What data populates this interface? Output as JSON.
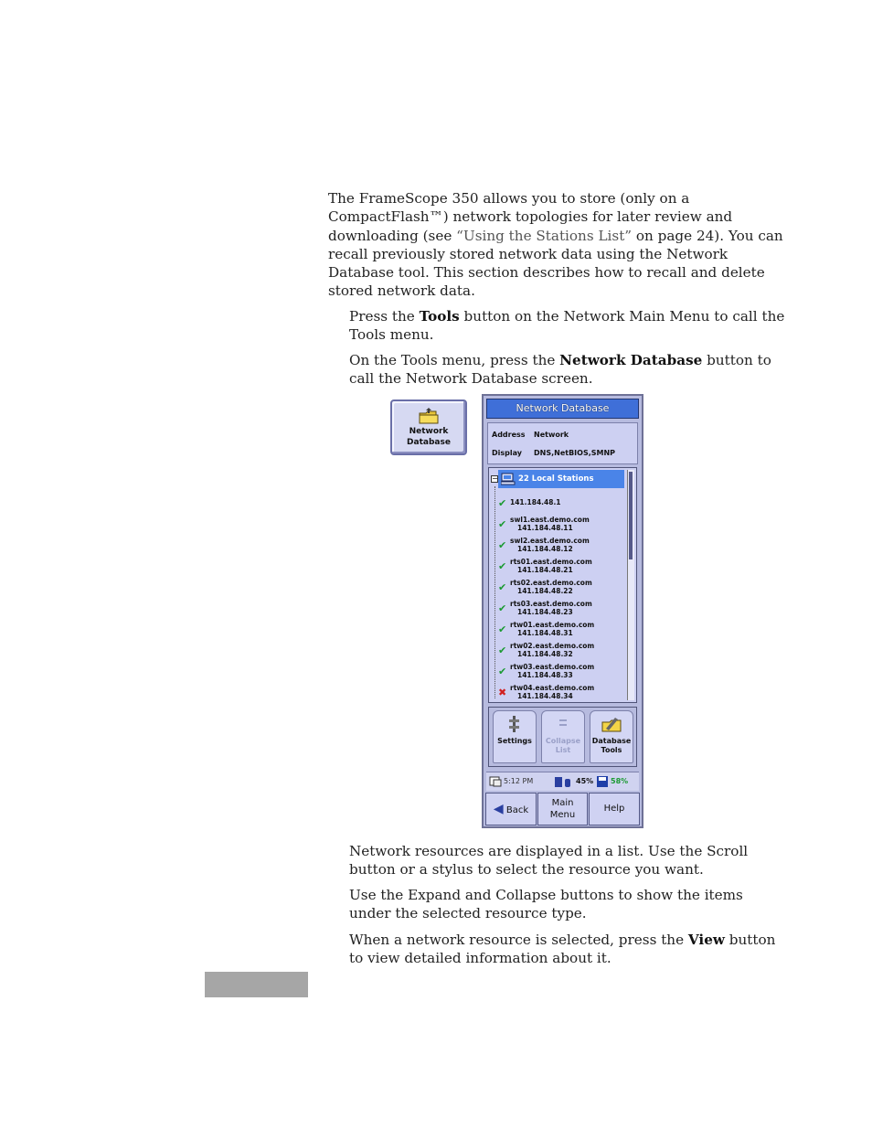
{
  "document": {
    "intro_before_link": "The FrameScope 350 allows you to store (only on a CompactFlash™) network topologies for later review and downloading (see ",
    "intro_link": "“Using the Stations List”",
    "intro_after_link": " on page 24). You can recall previously stored network data using the Network Database tool. This section describes how to recall and delete stored network data.",
    "step1_pre": "Press the ",
    "step1_bold": "Tools",
    "step1_post": " button on the Network Main Menu to call the Tools menu.",
    "step2_pre": "On the Tools menu, press the ",
    "step2_bold": "Network Database",
    "step2_post": " button to call the Network Database screen.",
    "note1": "Network resources are displayed in a list. Use the Scroll button or a stylus to select the resource you want.",
    "note2": "Use the Expand and Collapse buttons to show the items under the selected resource type.",
    "note3_pre": "When a network resource is selected, press the ",
    "note3_bold": "View",
    "note3_post": " button to view detailed information about it."
  },
  "nd_button": {
    "line1": "Network",
    "line2": "Database",
    "icon": "folder-icon"
  },
  "screen": {
    "title": "Network Database",
    "address_label": "Address",
    "address_value": "Network",
    "display_label": "Display",
    "display_value": "DNS,NetBIOS,SMNP",
    "list_header": "22 Local Stations",
    "expander": "−",
    "items": [
      {
        "status": "ok",
        "name": "141.184.48.1",
        "addr": ""
      },
      {
        "status": "ok",
        "name": "swl1.east.demo.com",
        "addr": "141.184.48.11"
      },
      {
        "status": "ok",
        "name": "swl2.east.demo.com",
        "addr": "141.184.48.12"
      },
      {
        "status": "ok",
        "name": "rts01.east.demo.com",
        "addr": "141.184.48.21"
      },
      {
        "status": "ok",
        "name": "rts02.east.demo.com",
        "addr": "141.184.48.22"
      },
      {
        "status": "ok",
        "name": "rts03.east.demo.com",
        "addr": "141.184.48.23"
      },
      {
        "status": "ok",
        "name": "rtw01.east.demo.com",
        "addr": "141.184.48.31"
      },
      {
        "status": "ok",
        "name": "rtw02.east.demo.com",
        "addr": "141.184.48.32"
      },
      {
        "status": "ok",
        "name": "rtw03.east.demo.com",
        "addr": "141.184.48.33"
      },
      {
        "status": "bad",
        "name": "rtw04.east.demo.com",
        "addr": "141.184.48.34"
      }
    ],
    "tools": {
      "settings": {
        "line1": "Settings",
        "line2": "",
        "icon": "settings-icon"
      },
      "collapse": {
        "line1": "Collapse",
        "line2": "List",
        "icon": "collapse-icon"
      },
      "dbtools": {
        "line1": "Database",
        "line2": "Tools",
        "icon": "database-tools-icon"
      }
    },
    "status": {
      "time": "5:12 PM",
      "battery": "45%",
      "disk": "58%"
    },
    "nav": {
      "back": "Back",
      "main1": "Main",
      "main2": "Menu",
      "help": "Help"
    }
  }
}
